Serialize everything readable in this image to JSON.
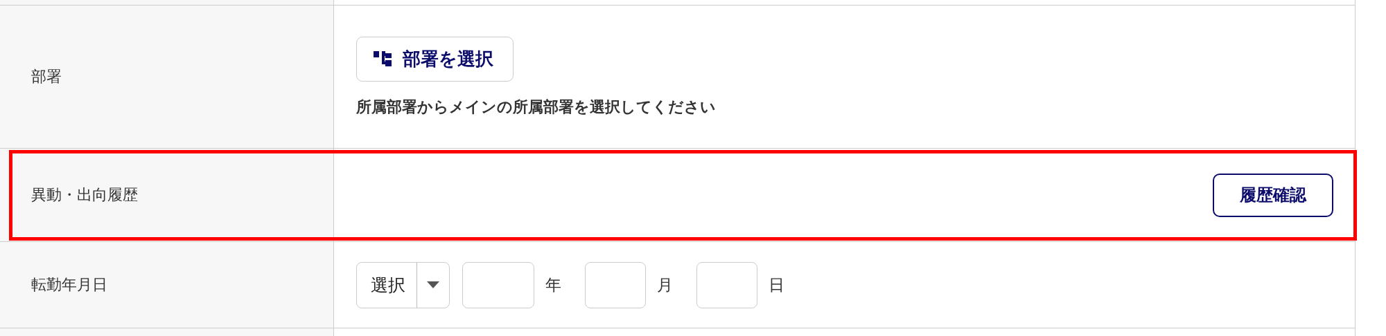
{
  "rows": [
    {
      "kind": "department",
      "label": "部署",
      "button": "部署を選択",
      "hint": "所属部署からメインの所属部署を選択してください",
      "highlighted": false
    },
    {
      "kind": "history",
      "label": "異動・出向履歴",
      "button": "履歴確認",
      "highlighted": true
    },
    {
      "kind": "date",
      "label": "転勤年月日",
      "select": "選択",
      "units": [
        "年",
        "月",
        "日"
      ],
      "highlighted": false
    }
  ]
}
